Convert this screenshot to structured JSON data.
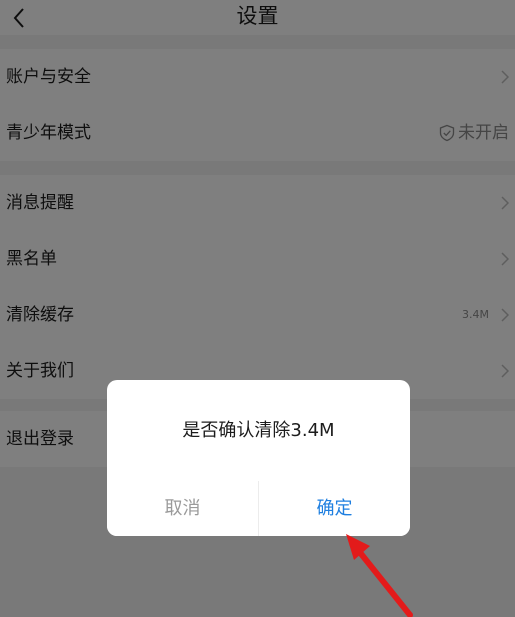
{
  "header": {
    "title": "设置",
    "back_icon": "chevron-left-icon"
  },
  "settings": {
    "account_security": {
      "label": "账户与安全"
    },
    "youth_mode": {
      "label": "青少年模式",
      "status": "未开启",
      "status_icon": "shield-check-icon"
    },
    "notifications": {
      "label": "消息提醒"
    },
    "blacklist": {
      "label": "黑名单"
    },
    "clear_cache": {
      "label": "清除缓存",
      "value": "3.4M"
    },
    "about": {
      "label": "关于我们"
    },
    "logout": {
      "label": "退出登录"
    }
  },
  "dialog": {
    "message": "是否确认清除3.4M",
    "cancel_label": "取消",
    "confirm_label": "确定"
  },
  "colors": {
    "accent": "#1f7fe0",
    "annotation_arrow": "#e31b1b"
  }
}
